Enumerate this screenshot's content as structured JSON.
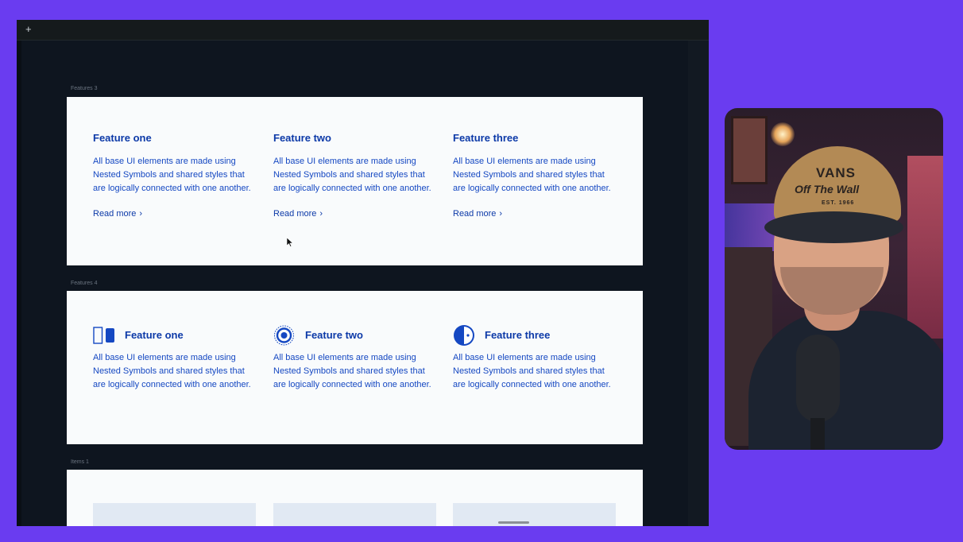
{
  "toolbar": {
    "add_icon": "+"
  },
  "sections": [
    {
      "label": "Features 3",
      "features": [
        {
          "title": "Feature one",
          "body": "All base UI elements are made using Nested Symbols and shared styles that are logically connected with one another.",
          "link": "Read more"
        },
        {
          "title": "Feature two",
          "body": "All base UI elements are made using Nested Symbols and shared styles that are logically connected with one another.",
          "link": "Read more"
        },
        {
          "title": "Feature three",
          "body": "All base UI elements are made using Nested Symbols and shared styles that are logically connected with one another.",
          "link": "Read more"
        }
      ]
    },
    {
      "label": "Features 4",
      "features": [
        {
          "icon": "toggle-panels-icon",
          "title": "Feature one",
          "body": "All base UI elements are made using Nested Symbols and shared styles that are logically connected with one another."
        },
        {
          "icon": "target-icon",
          "title": "Feature two",
          "body": "All base UI elements are made using Nested Symbols and shared styles that are logically connected with one another."
        },
        {
          "icon": "half-circle-icon",
          "title": "Feature three",
          "body": "All base UI elements are made using Nested Symbols and shared styles that are logically connected with one another."
        }
      ]
    },
    {
      "label": "Items 1"
    }
  ],
  "webcam": {
    "cap_brand": "VANS",
    "cap_slogan": "Off The Wall",
    "cap_est": "EST. 1966"
  },
  "colors": {
    "background": "#6a3cf0",
    "canvas": "#0e151f",
    "accent": "#1548c2"
  }
}
